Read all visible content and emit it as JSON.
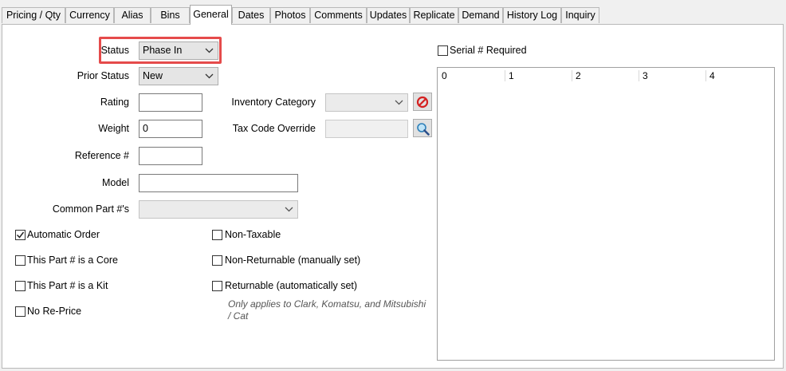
{
  "tabs": [
    {
      "label": "Pricing / Qty"
    },
    {
      "label": "Currency"
    },
    {
      "label": "Alias"
    },
    {
      "label": "Bins"
    },
    {
      "label": "General"
    },
    {
      "label": "Dates"
    },
    {
      "label": "Photos"
    },
    {
      "label": "Comments"
    },
    {
      "label": "Updates"
    },
    {
      "label": "Replicate"
    },
    {
      "label": "Demand"
    },
    {
      "label": "History Log"
    },
    {
      "label": "Inquiry"
    }
  ],
  "active_tab": "General",
  "form": {
    "status": {
      "label": "Status",
      "value": "Phase In"
    },
    "prior_status": {
      "label": "Prior Status",
      "value": "New"
    },
    "rating": {
      "label": "Rating",
      "value": ""
    },
    "weight": {
      "label": "Weight",
      "value": "0"
    },
    "reference": {
      "label": "Reference #",
      "value": ""
    },
    "model": {
      "label": "Model",
      "value": ""
    },
    "common_part": {
      "label": "Common Part #'s",
      "value": ""
    },
    "inventory_category": {
      "label": "Inventory Category",
      "value": ""
    },
    "tax_code_override": {
      "label": "Tax Code Override",
      "value": ""
    }
  },
  "checkboxes": {
    "automatic_order": {
      "label": "Automatic Order",
      "checked": true
    },
    "is_core": {
      "label": "This Part # is a Core",
      "checked": false
    },
    "is_kit": {
      "label": "This Part # is a Kit",
      "checked": false
    },
    "no_reprice": {
      "label": "No Re-Price",
      "checked": false
    },
    "non_taxable": {
      "label": "Non-Taxable",
      "checked": false
    },
    "non_returnable": {
      "label": "Non-Returnable (manually set)",
      "checked": false
    },
    "returnable": {
      "label": "Returnable (automatically set)",
      "checked": false
    },
    "serial_required": {
      "label": "Serial # Required",
      "checked": false
    }
  },
  "returnable_note": [
    "Only applies to Clark, Komatsu, and Mitsubishi",
    "/ Cat"
  ],
  "serial_grid": {
    "columns": [
      "0",
      "1",
      "2",
      "3",
      "4"
    ]
  },
  "icons": {
    "clear": "no-entry-icon",
    "search": "magnifier-icon"
  }
}
